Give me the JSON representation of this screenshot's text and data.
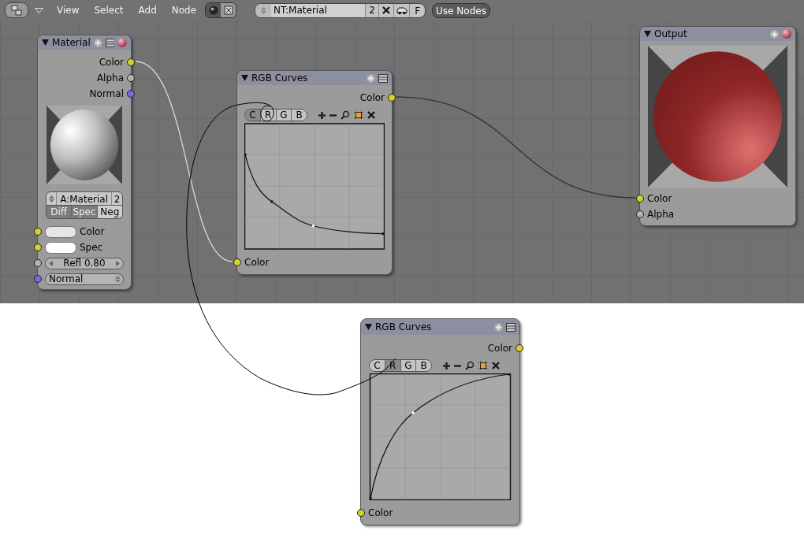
{
  "header": {
    "menus": [
      "View",
      "Select",
      "Add",
      "Node"
    ],
    "node_tree": "NT:Material",
    "users": "2",
    "fake_user": "F",
    "use_nodes": {
      "label": "Use Nodes",
      "on": true
    }
  },
  "nodes": [
    {
      "kind": "material",
      "title": "Material",
      "outputs": [
        {
          "label": "Color",
          "color": "#d2d22c"
        },
        {
          "label": "Alpha",
          "color": "#b4b4b4"
        },
        {
          "label": "Normal",
          "color": "#6e6ee6"
        }
      ],
      "material": "A:Material",
      "material_users": "2",
      "toggles": [
        {
          "label": "Diff",
          "selected": true
        },
        {
          "label": "Spec",
          "selected": true
        },
        {
          "label": "Neg",
          "selected": false
        }
      ],
      "inputs": [
        {
          "kind": "swatch",
          "label": "Color",
          "color": "#d2d22c",
          "swatch": {
            "color": "#e6e6e6"
          }
        },
        {
          "kind": "swatch",
          "label": "Spec",
          "color": "#d2d22c",
          "swatch": {
            "color": "#ffffff"
          }
        },
        {
          "kind": "number",
          "label": "Refl 0.80",
          "color": "#b4b4b4"
        },
        {
          "kind": "menu",
          "label": "Normal",
          "color": "#6e6ee6"
        }
      ]
    },
    {
      "kind": "curves",
      "title": "RGB Curves",
      "outputs": [
        {
          "label": "Color",
          "color": "#d2d22c"
        }
      ],
      "channels": [
        {
          "label": "C",
          "selected": true
        },
        {
          "label": "R",
          "selected": false
        },
        {
          "label": "G",
          "selected": false
        },
        {
          "label": "B",
          "selected": false
        }
      ],
      "curve": {
        "kind": "falling"
      },
      "inputs": [
        {
          "label": "Color",
          "color": "#d2d22c"
        }
      ]
    },
    {
      "kind": "output",
      "title": "Output",
      "inputs": [
        {
          "label": "Color",
          "color": "#d2d22c"
        },
        {
          "label": "Alpha",
          "color": "#b4b4b4"
        }
      ]
    },
    {
      "kind": "curves",
      "title": "RGB Curves",
      "outputs": [
        {
          "label": "Color",
          "color": "#d2d22c"
        }
      ],
      "channels": [
        {
          "label": "C",
          "selected": false
        },
        {
          "label": "R",
          "selected": true
        },
        {
          "label": "G",
          "selected": false
        },
        {
          "label": "B",
          "selected": false
        }
      ],
      "curve": {
        "kind": "rising"
      },
      "inputs": [
        {
          "label": "Color",
          "color": "#d2d22c"
        }
      ]
    }
  ]
}
